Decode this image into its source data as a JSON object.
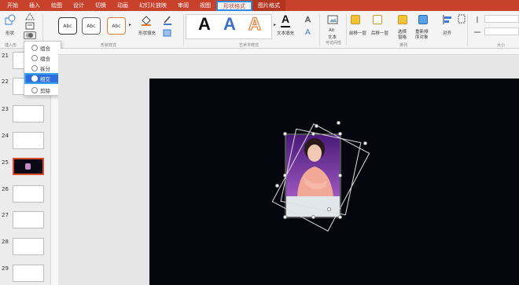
{
  "tabs": [
    "开始",
    "插入",
    "绘图",
    "设计",
    "切换",
    "动画",
    "幻灯片放映",
    "审阅",
    "视图",
    "形状格式",
    "图片格式"
  ],
  "ribbon": {
    "shape_label": "形状",
    "insert_shapes_group": "插入形",
    "shape_styles_group": "形状样式",
    "style_sample": "Abc",
    "shape_fill": "形状填充",
    "wordart_group": "艺术字样式",
    "wordart_letter": "A",
    "text_fill": "文本填充",
    "accessibility_group": "可访问性",
    "alt_text": "Alt\n文本",
    "alt_text_line1": "Alt",
    "alt_text_line2": "文本",
    "arrange_group": "排列",
    "bring_forward": "前移一层",
    "send_backward": "后移一层",
    "selection_pane_1": "选择",
    "selection_pane_2": "窗格",
    "reorder_1": "重新排",
    "reorder_2": "序对象",
    "align": "对齐",
    "size_group": "大小"
  },
  "merge_menu": {
    "items": [
      "组合",
      "组合",
      "拆分",
      "相交",
      "剪除"
    ],
    "selected": "相交"
  },
  "slides": {
    "numbers": [
      "21",
      "22",
      "23",
      "24",
      "25",
      "26",
      "27",
      "28",
      "29"
    ],
    "current": "25"
  },
  "colors": {
    "tab_bar": "#c8412a",
    "highlight": "#2e6de0",
    "slide_bg": "#06060f"
  }
}
